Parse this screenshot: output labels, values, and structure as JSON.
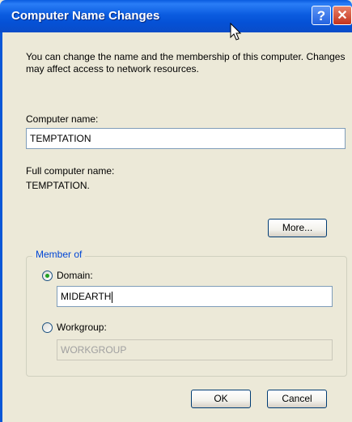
{
  "window": {
    "title": "Computer Name Changes",
    "help_glyph": "?",
    "close_glyph": "✕"
  },
  "description": "You can change the name and the membership of this computer. Changes may affect access to network resources.",
  "computer_name": {
    "label": "Computer name:",
    "value": "TEMPTATION"
  },
  "full_name": {
    "label": "Full computer name:",
    "value": "TEMPTATION."
  },
  "more_button": "More...",
  "member_of": {
    "title": "Member of",
    "domain": {
      "label": "Domain:",
      "value": "MIDEARTH",
      "selected": true
    },
    "workgroup": {
      "label": "Workgroup:",
      "value": "WORKGROUP",
      "selected": false
    }
  },
  "buttons": {
    "ok": "OK",
    "cancel": "Cancel"
  }
}
